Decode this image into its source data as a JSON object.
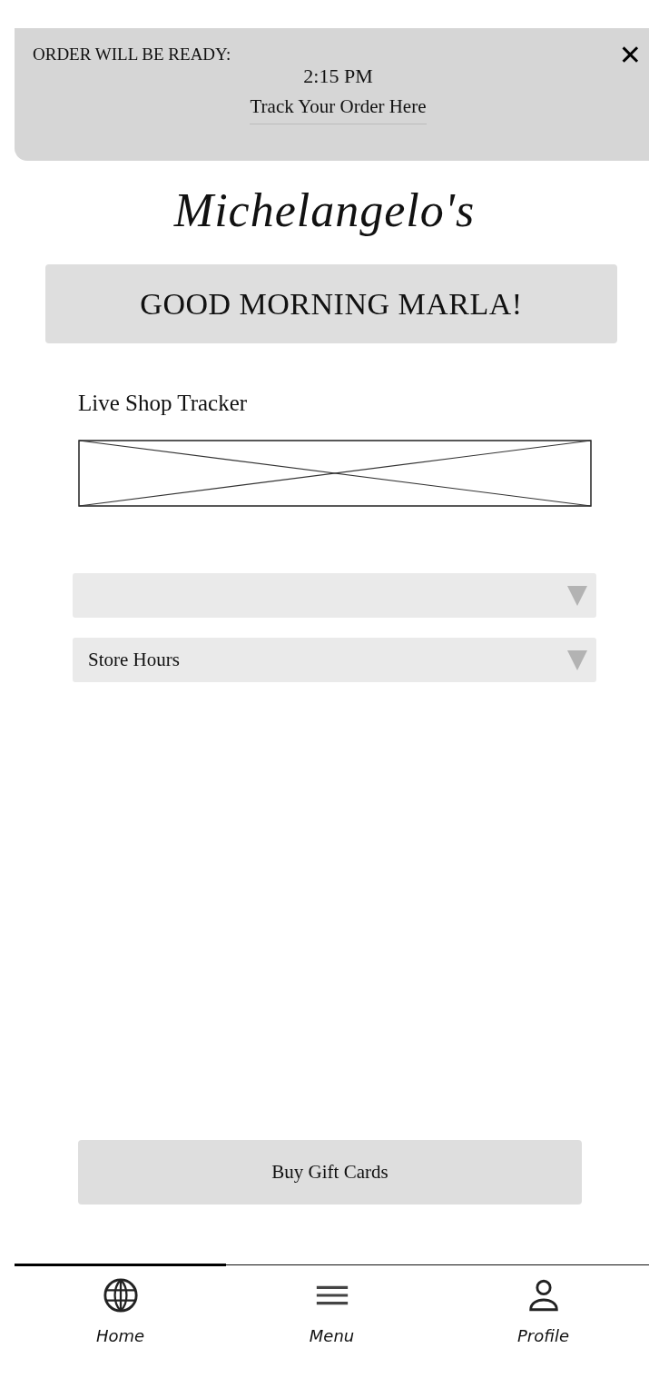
{
  "order_banner": {
    "heading": "ORDER WILL BE READY:",
    "time": "2:15 PM",
    "link": "Track Your Order Here",
    "close": "✕"
  },
  "logo": "Michelangelo's",
  "greeting": "GOOD MORNING MARLA!",
  "tracker": {
    "label": "Live Shop Tracker"
  },
  "dropdowns": [
    {
      "expanded": false
    },
    {
      "label": "Store Hours",
      "expanded": false
    }
  ],
  "gift_button": "Buy Gift Cards",
  "nav": [
    {
      "label": "Home",
      "kind": "globe",
      "selected": true
    },
    {
      "label": "Menu",
      "kind": "menu",
      "selected": false
    },
    {
      "label": "Profile",
      "kind": "person",
      "selected": false
    }
  ]
}
